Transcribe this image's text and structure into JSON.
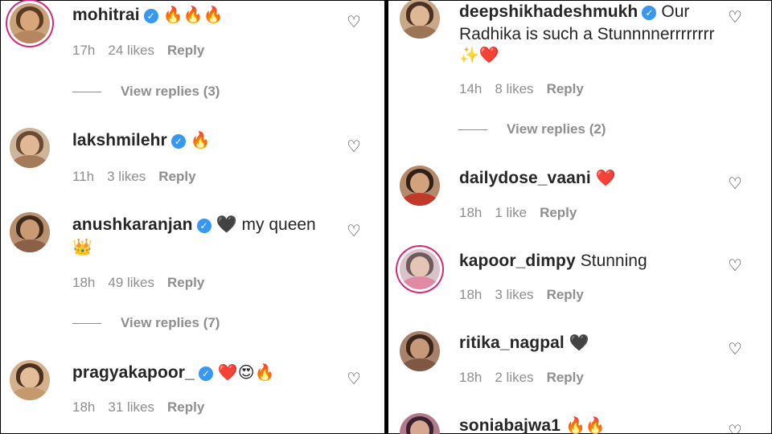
{
  "left": {
    "comments": [
      {
        "username": "mohitrai",
        "verified": true,
        "text": "🔥🔥🔥",
        "text2": "",
        "time": "17h",
        "likes": "24 likes",
        "reply": "Reply",
        "view_replies": "View replies (3)"
      },
      {
        "username": "lakshmilehr",
        "verified": true,
        "text": "🔥",
        "text2": "",
        "time": "11h",
        "likes": "3 likes",
        "reply": "Reply",
        "view_replies": ""
      },
      {
        "username": "anushkaranjan",
        "verified": true,
        "text": "🖤 my queen",
        "text2": "👑",
        "time": "18h",
        "likes": "49 likes",
        "reply": "Reply",
        "view_replies": "View replies (7)"
      },
      {
        "username": "pragyakapoor_",
        "verified": true,
        "text": "❤️😍🔥",
        "text2": "",
        "time": "18h",
        "likes": "31 likes",
        "reply": "Reply",
        "view_replies": ""
      }
    ]
  },
  "right": {
    "comments": [
      {
        "username": "deepshikhadeshmukh",
        "verified": true,
        "text": "Our",
        "text2": "Radhika is such a Stunnnnerrrrrrrr",
        "text3": "✨❤️",
        "time": "14h",
        "likes": "8 likes",
        "reply": "Reply",
        "view_replies": "View replies (2)"
      },
      {
        "username": "dailydose_vaani",
        "verified": false,
        "text": "❤️",
        "time": "18h",
        "likes": "1 like",
        "reply": "Reply",
        "view_replies": ""
      },
      {
        "username": "kapoor_dimpy",
        "verified": false,
        "text": "Stunning",
        "time": "18h",
        "likes": "3 likes",
        "reply": "Reply",
        "view_replies": ""
      },
      {
        "username": "ritika_nagpal",
        "verified": false,
        "text": "🖤",
        "time": "18h",
        "likes": "2 likes",
        "reply": "Reply",
        "view_replies": ""
      },
      {
        "username": "soniabajwa1",
        "verified": false,
        "text": "🔥🔥",
        "time": "",
        "likes": "",
        "reply": "",
        "view_replies": ""
      }
    ]
  },
  "icons": {
    "heart": "heart-outline-icon",
    "verified": "verified-badge-icon"
  },
  "colors": {
    "verified": "#3897f0",
    "meta": "#8e8e8e",
    "text": "#262626",
    "story_ring": "#d62976"
  }
}
